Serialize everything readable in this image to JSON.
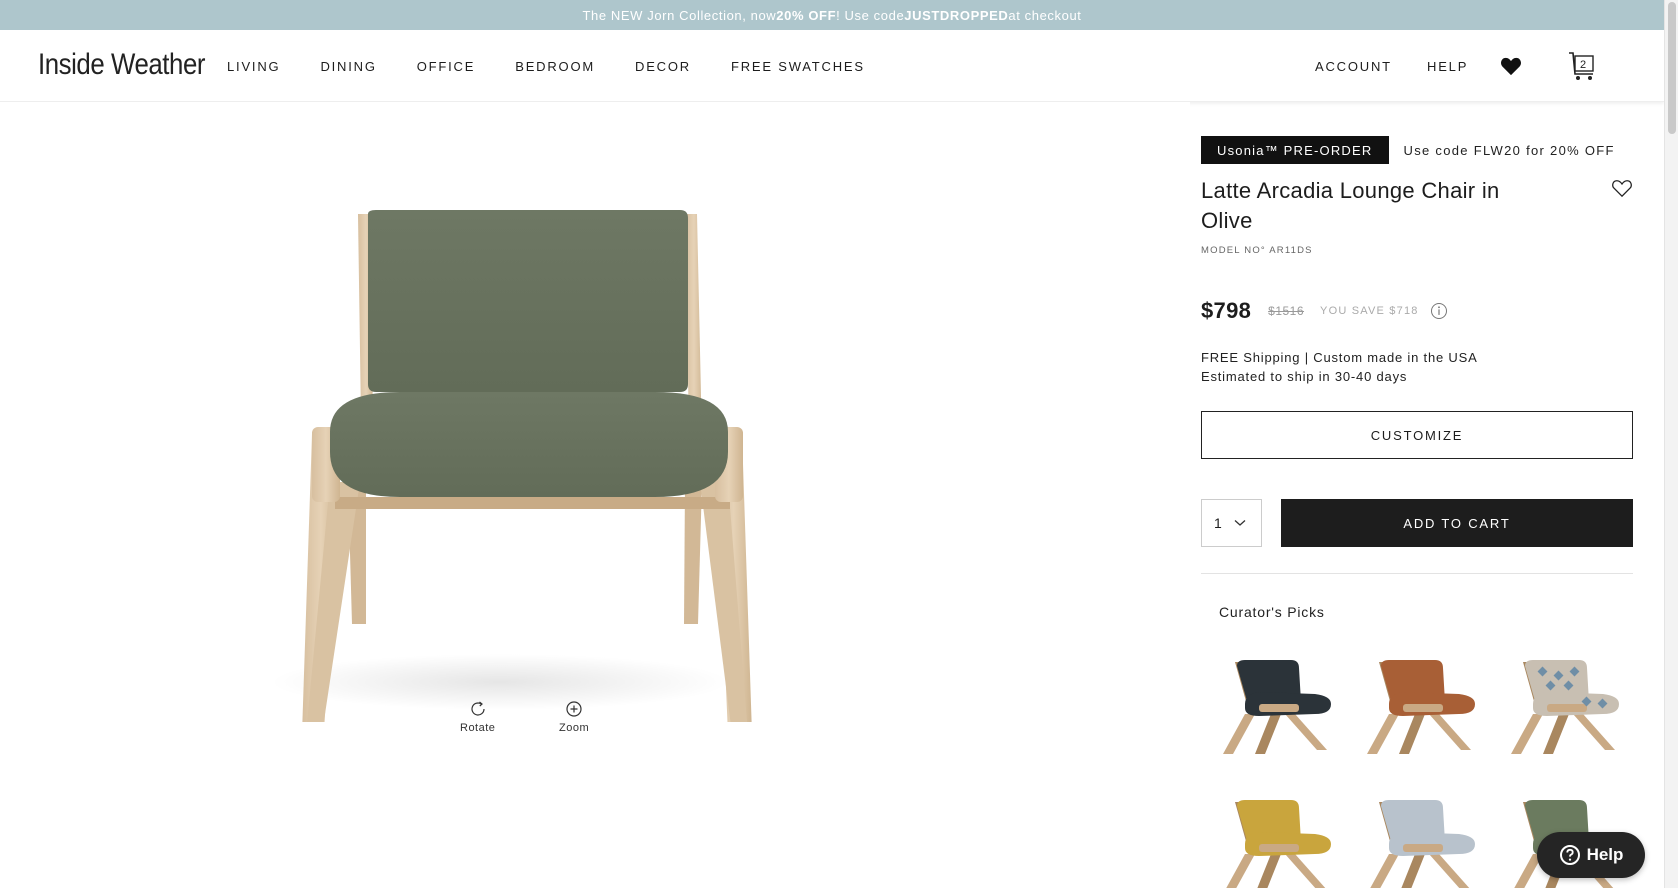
{
  "promo": {
    "text1": "The NEW Jorn Collection, now ",
    "bold1": "20% OFF",
    "text2": "! Use code ",
    "bold2": "JUSTDROPPED",
    "text3": " at checkout"
  },
  "header": {
    "logo": "Inside Weather",
    "nav": [
      "LIVING",
      "DINING",
      "OFFICE",
      "BEDROOM",
      "DECOR",
      "FREE SWATCHES"
    ],
    "account": "ACCOUNT",
    "help": "HELP",
    "cart_count": "2"
  },
  "gallery": {
    "rotate_label": "Rotate",
    "zoom_label": "Zoom"
  },
  "product": {
    "badge": "Usonia™ PRE-ORDER",
    "promo_code": "Use code FLW20 for 20% OFF",
    "title": "Latte Arcadia Lounge Chair in Olive",
    "model": "MODEL NO° AR11DS",
    "price": "$798",
    "price_was": "$1516",
    "savings": "YOU SAVE $718",
    "shipping_line1": "FREE Shipping | Custom made in the USA",
    "shipping_line2": "Estimated to ship in 30-40 days",
    "customize_label": "CUSTOMIZE",
    "quantity": "1",
    "add_to_cart_label": "ADD TO CART"
  },
  "curators_picks": {
    "title": "Curator's Picks",
    "items": [
      {
        "color": "#2b3339",
        "name": "charcoal-chair"
      },
      {
        "color": "#a85f36",
        "name": "rust-chair"
      },
      {
        "color": "#c8bfb2",
        "name": "pattern-chair",
        "accent": "#6f8ea6"
      },
      {
        "color": "#c9a53d",
        "name": "mustard-chair"
      },
      {
        "color": "#b8c2cc",
        "name": "light-blue-chair"
      },
      {
        "color": "#6b7b5f",
        "name": "olive-chair"
      }
    ]
  },
  "help_widget": {
    "label": "Help"
  },
  "colors": {
    "promo_bar": "#aec6cc",
    "primary_button": "#1d1d1d",
    "olive_fabric": "#6b7560",
    "wood": "#dcc4a4"
  }
}
